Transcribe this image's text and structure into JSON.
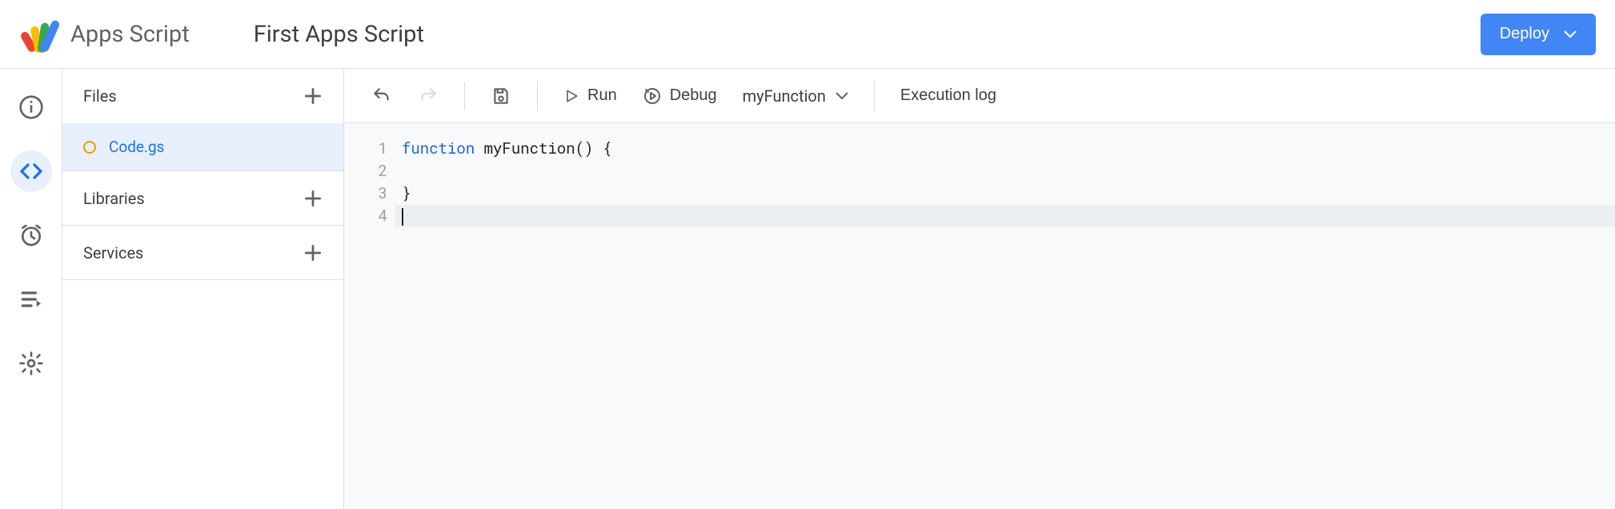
{
  "header": {
    "app_name": "Apps Script",
    "project_title": "First Apps Script",
    "deploy_label": "Deploy"
  },
  "rail": {
    "items": [
      {
        "name": "overview-icon"
      },
      {
        "name": "editor-icon"
      },
      {
        "name": "triggers-icon"
      },
      {
        "name": "executions-icon"
      },
      {
        "name": "settings-icon"
      }
    ],
    "active_index": 1
  },
  "files_pane": {
    "files_label": "Files",
    "libraries_label": "Libraries",
    "services_label": "Services",
    "files": [
      {
        "name": "Code.gs",
        "dirty": true
      }
    ]
  },
  "toolbar": {
    "run_label": "Run",
    "debug_label": "Debug",
    "selected_function": "myFunction",
    "execution_log_label": "Execution log"
  },
  "editor": {
    "line_numbers": [
      "1",
      "2",
      "3",
      "4"
    ],
    "code_lines": [
      {
        "tokens": [
          {
            "t": "function ",
            "c": "kw"
          },
          {
            "t": "myFunction() {",
            "c": ""
          }
        ]
      },
      {
        "tokens": [
          {
            "t": "  ",
            "c": ""
          }
        ]
      },
      {
        "tokens": [
          {
            "t": "}",
            "c": ""
          }
        ]
      },
      {
        "tokens": []
      }
    ],
    "cursor_line": 3
  }
}
